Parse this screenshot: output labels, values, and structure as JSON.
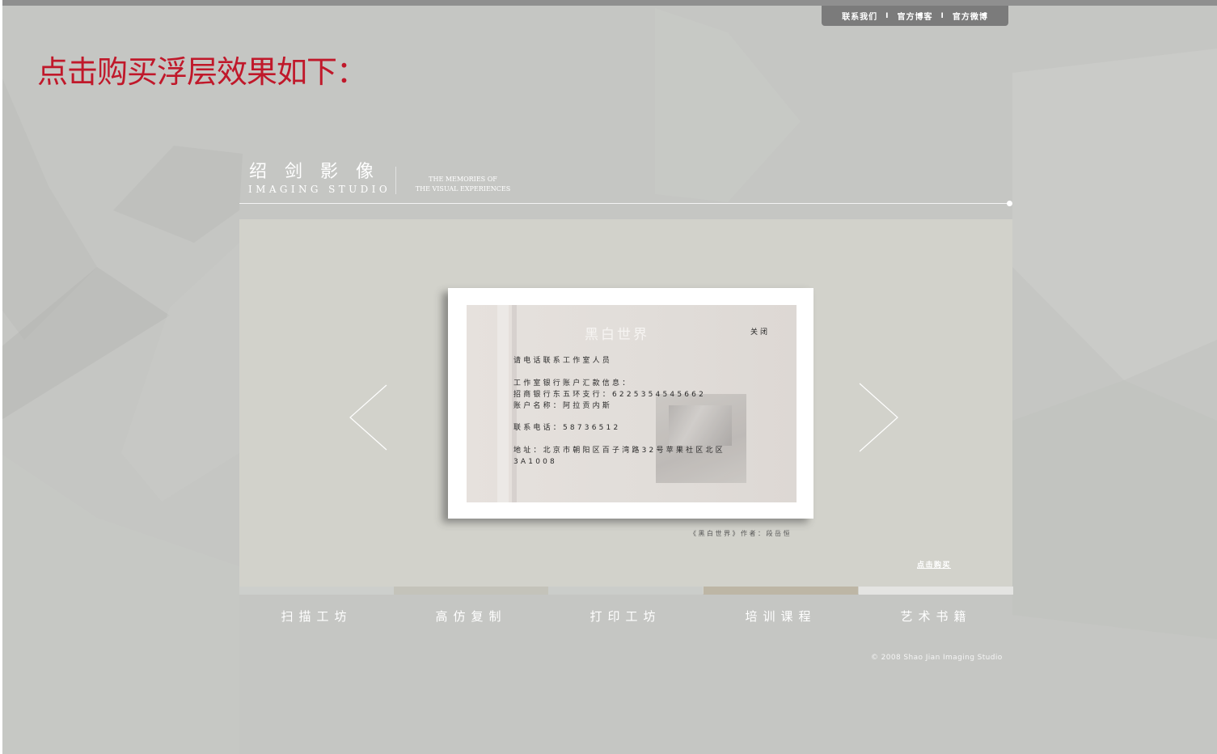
{
  "top_nav": {
    "items": [
      "联系我们",
      "官方博客",
      "官方微博"
    ],
    "separator": "I",
    "background": "#7b7b7b"
  },
  "headline": {
    "text": "点击购买浮层效果如下：",
    "color": "#c0182a"
  },
  "logo": {
    "name_cn": "绍剑影像",
    "name_en": "IMAGING STUDIO",
    "tagline_1": "THE MEMORIES OF",
    "tagline_2": "THE VISUAL EXPERIENCES"
  },
  "modal": {
    "photo_watermark": "黑白世界",
    "close_label": "关闭",
    "lines": [
      "请电话联系工作室人员",
      "工作室银行账户汇款信息：",
      "招商银行东五环支行：6225354545662",
      "账户名称：阿拉贡内斯",
      "联系电话：58736512",
      "地址：北京市朝阳区百子湾路32号苹果社区北区",
      "3A1008"
    ]
  },
  "caption": "《黑白世界》作者：段岳恒",
  "buy_link": "点击购买",
  "menu": {
    "items": [
      {
        "label": "扫描工坊",
        "bar_color": "#cdcfcc"
      },
      {
        "label": "高仿复制",
        "bar_color": "#c4c3ba"
      },
      {
        "label": "打印工坊",
        "bar_color": "#cbcdca"
      },
      {
        "label": "培训课程",
        "bar_color": "#bdb6a5"
      },
      {
        "label": "艺术书籍",
        "bar_color": "#e4e4e2"
      }
    ]
  },
  "copyright": "© 2008 Shao Jian Imaging Studio",
  "colors": {
    "page_background": "#c5c6c3",
    "stage_background": "#d2d2cb",
    "accent_red": "#c0182a"
  }
}
